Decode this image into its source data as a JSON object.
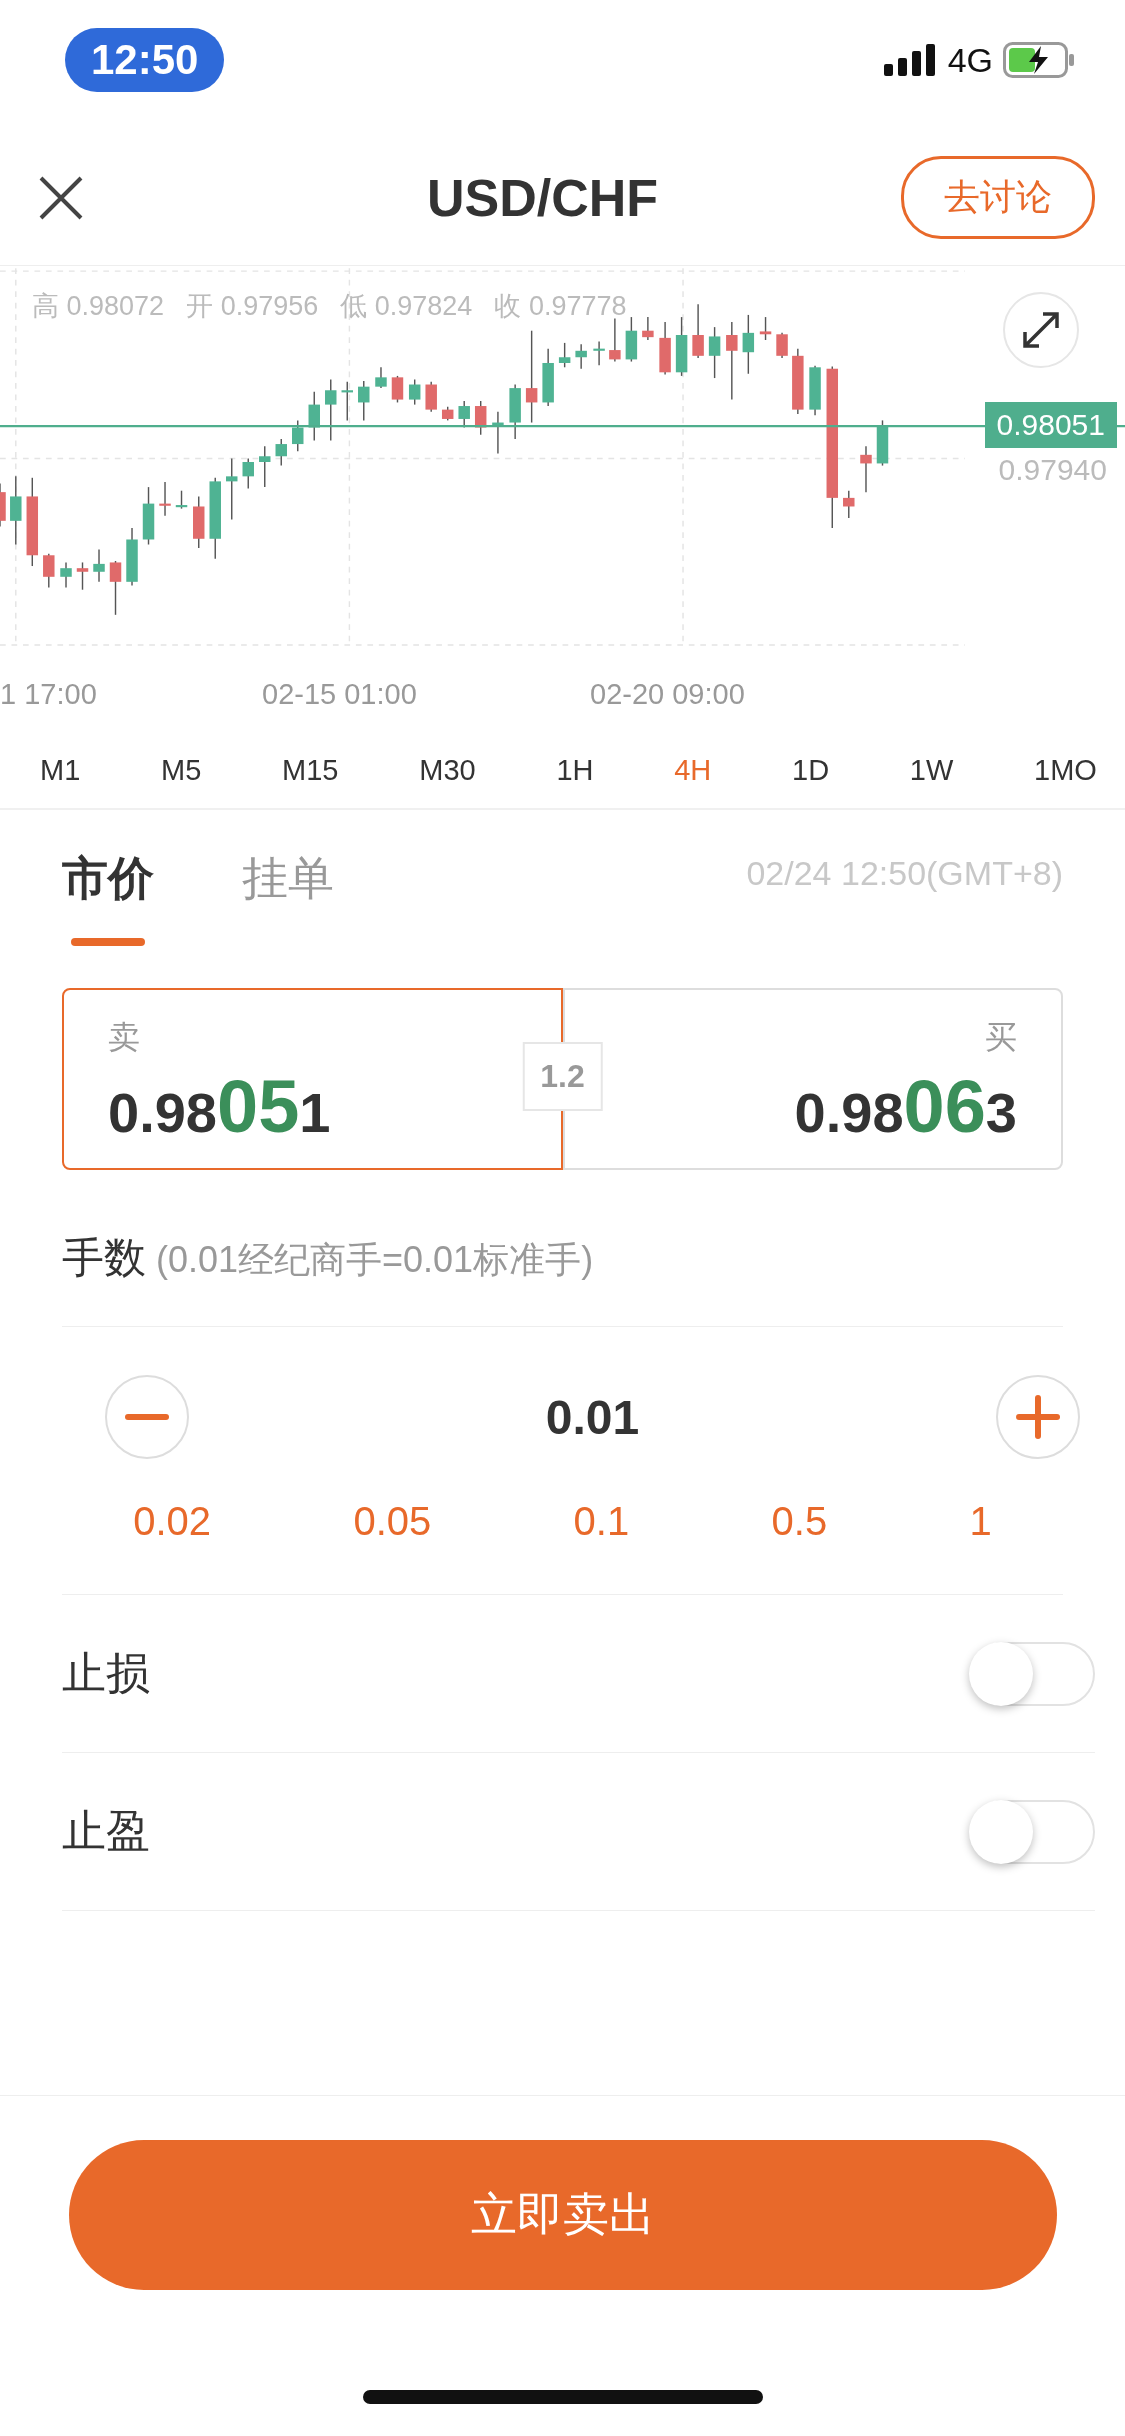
{
  "status_bar": {
    "time": "12:50",
    "network": "4G"
  },
  "header": {
    "title": "USD/CHF",
    "discuss_button": "去讨论"
  },
  "chart": {
    "ohlc": [
      {
        "label": "高",
        "value": "0.98072"
      },
      {
        "label": "开",
        "value": "0.97956"
      },
      {
        "label": "低",
        "value": "0.97824"
      },
      {
        "label": "收",
        "value": "0.97778"
      }
    ],
    "current_price": "0.98051",
    "price_label": "0.97940",
    "time_labels": [
      "1 17:00",
      "02-15 01:00",
      "02-20 09:00"
    ]
  },
  "periods": [
    {
      "label": "M1",
      "selected": false
    },
    {
      "label": "M5",
      "selected": false
    },
    {
      "label": "M15",
      "selected": false
    },
    {
      "label": "M30",
      "selected": false
    },
    {
      "label": "1H",
      "selected": false
    },
    {
      "label": "4H",
      "selected": true
    },
    {
      "label": "1D",
      "selected": false
    },
    {
      "label": "1W",
      "selected": false
    },
    {
      "label": "1MO",
      "selected": false
    }
  ],
  "order_tabs": [
    {
      "label": "市价",
      "selected": true
    },
    {
      "label": "挂单",
      "selected": false
    }
  ],
  "timestamp": "02/24 12:50(GMT+8)",
  "quotes": [
    {
      "label": "卖",
      "selected": true,
      "price_prefix": "0.98",
      "price_big": "05",
      "price_suffix": "1"
    },
    {
      "label": "买",
      "selected": false,
      "price_prefix": "0.98",
      "price_big": "06",
      "price_suffix": "3"
    }
  ],
  "spread": "1.2",
  "lots": {
    "label": "手数",
    "hint": "(0.01经纪商手=0.01标准手)",
    "value": "0.01",
    "presets": [
      "0.02",
      "0.05",
      "0.1",
      "0.5",
      "1"
    ]
  },
  "toggles": [
    {
      "label": "止损",
      "on": false
    },
    {
      "label": "止盈",
      "on": false
    }
  ],
  "submit_button": "立即卖出"
}
